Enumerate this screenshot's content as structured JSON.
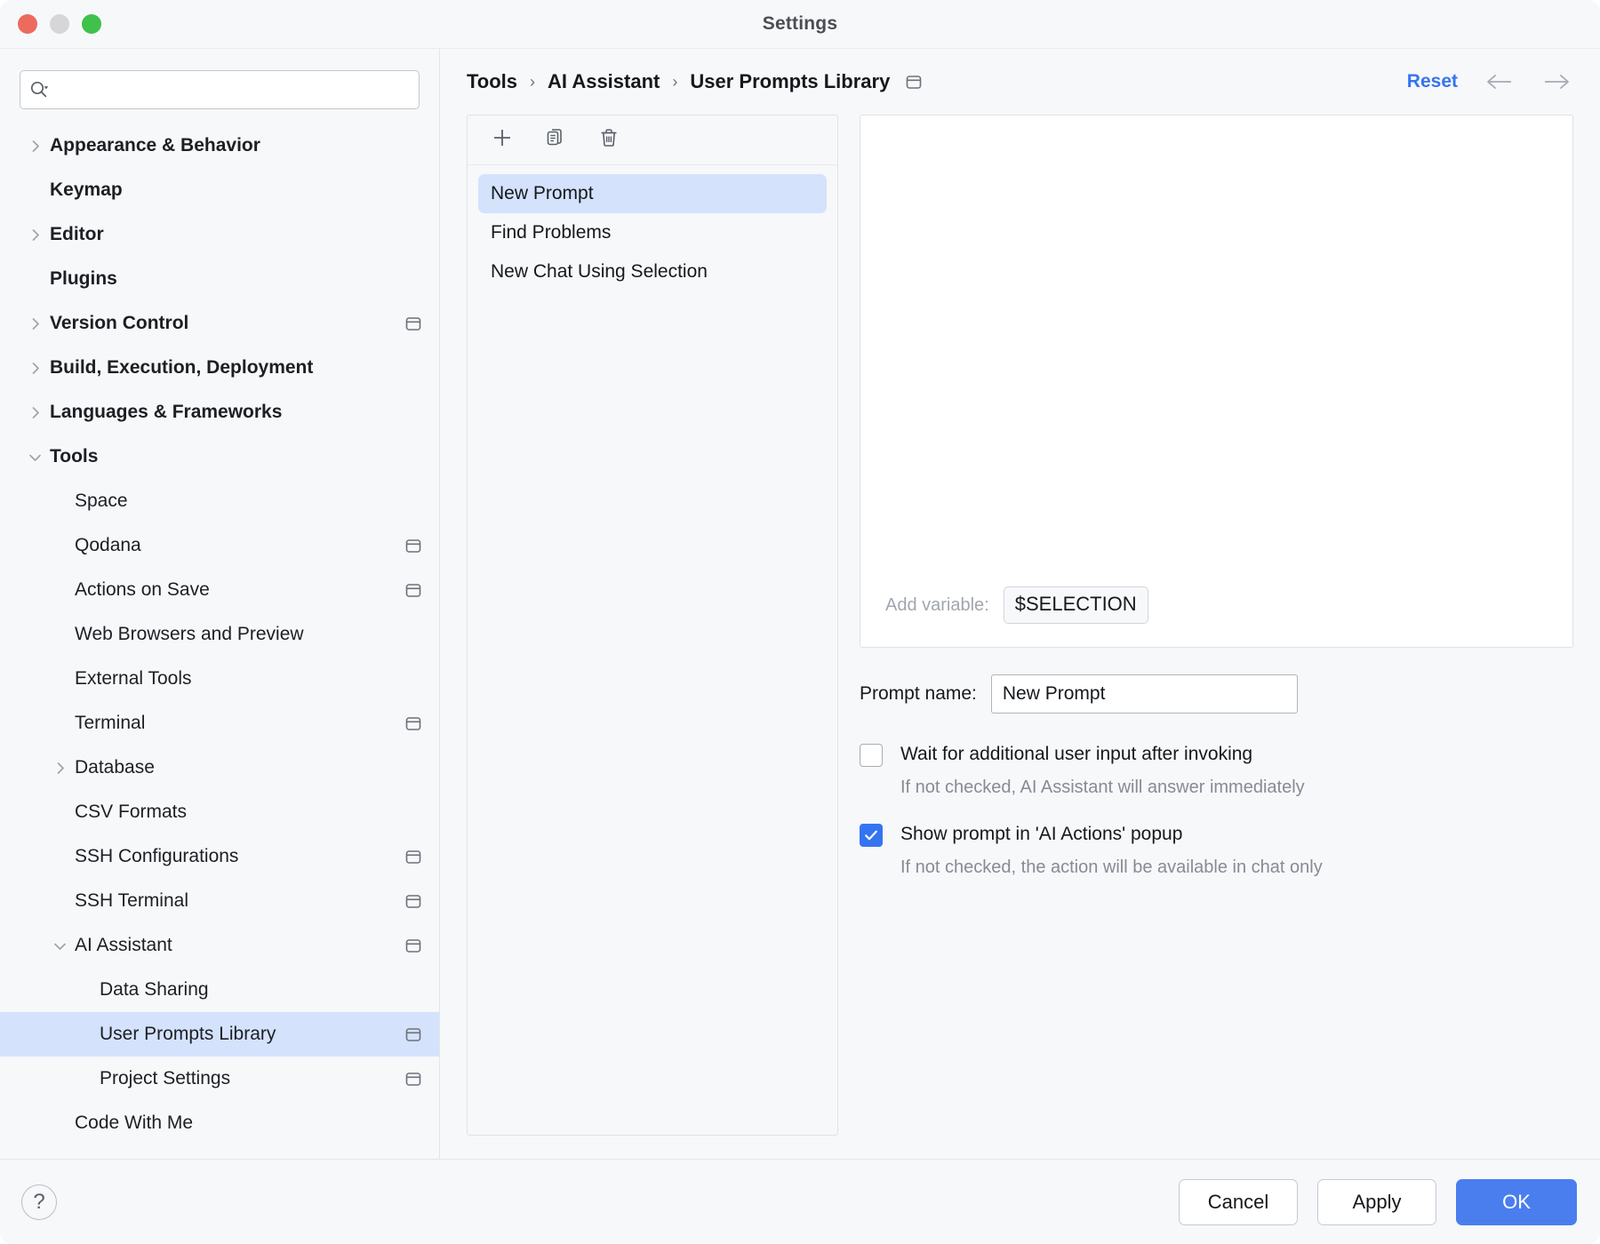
{
  "window": {
    "title": "Settings",
    "traffic_lights": [
      "close",
      "minimize",
      "zoom"
    ]
  },
  "search": {
    "value": "",
    "placeholder": ""
  },
  "sidebar": {
    "items": [
      {
        "label": "Appearance & Behavior",
        "level": 0,
        "twisty": "collapsed",
        "badge": false,
        "selected": false
      },
      {
        "label": "Keymap",
        "level": 0,
        "twisty": "none",
        "badge": false,
        "selected": false
      },
      {
        "label": "Editor",
        "level": 0,
        "twisty": "collapsed",
        "badge": false,
        "selected": false
      },
      {
        "label": "Plugins",
        "level": 0,
        "twisty": "none",
        "badge": false,
        "selected": false
      },
      {
        "label": "Version Control",
        "level": 0,
        "twisty": "collapsed",
        "badge": true,
        "selected": false
      },
      {
        "label": "Build, Execution, Deployment",
        "level": 0,
        "twisty": "collapsed",
        "badge": false,
        "selected": false
      },
      {
        "label": "Languages & Frameworks",
        "level": 0,
        "twisty": "collapsed",
        "badge": false,
        "selected": false
      },
      {
        "label": "Tools",
        "level": 0,
        "twisty": "expanded",
        "badge": false,
        "selected": false
      },
      {
        "label": "Space",
        "level": 1,
        "twisty": "none",
        "badge": false,
        "selected": false
      },
      {
        "label": "Qodana",
        "level": 1,
        "twisty": "none",
        "badge": true,
        "selected": false
      },
      {
        "label": "Actions on Save",
        "level": 1,
        "twisty": "none",
        "badge": true,
        "selected": false
      },
      {
        "label": "Web Browsers and Preview",
        "level": 1,
        "twisty": "none",
        "badge": false,
        "selected": false
      },
      {
        "label": "External Tools",
        "level": 1,
        "twisty": "none",
        "badge": false,
        "selected": false
      },
      {
        "label": "Terminal",
        "level": 1,
        "twisty": "none",
        "badge": true,
        "selected": false
      },
      {
        "label": "Database",
        "level": 1,
        "twisty": "collapsed",
        "badge": false,
        "selected": false
      },
      {
        "label": "CSV Formats",
        "level": 1,
        "twisty": "none",
        "badge": false,
        "selected": false
      },
      {
        "label": "SSH Configurations",
        "level": 1,
        "twisty": "none",
        "badge": true,
        "selected": false
      },
      {
        "label": "SSH Terminal",
        "level": 1,
        "twisty": "none",
        "badge": true,
        "selected": false
      },
      {
        "label": "AI Assistant",
        "level": 1,
        "twisty": "expanded",
        "badge": true,
        "selected": false
      },
      {
        "label": "Data Sharing",
        "level": 2,
        "twisty": "none",
        "badge": false,
        "selected": false
      },
      {
        "label": "User Prompts Library",
        "level": 2,
        "twisty": "none",
        "badge": true,
        "selected": true
      },
      {
        "label": "Project Settings",
        "level": 2,
        "twisty": "none",
        "badge": true,
        "selected": false
      },
      {
        "label": "Code With Me",
        "level": 1,
        "twisty": "none",
        "badge": false,
        "selected": false
      }
    ]
  },
  "header": {
    "breadcrumb": [
      "Tools",
      "AI Assistant",
      "User Prompts Library"
    ],
    "separator": "›",
    "badge": true,
    "reset_label": "Reset",
    "back_arrow": "←",
    "forward_arrow": "→",
    "reset_color": "#3574F0"
  },
  "prompt_list": {
    "toolbar": [
      {
        "name": "add-prompt",
        "icon": "plus-icon"
      },
      {
        "name": "duplicate-prompt",
        "icon": "copy-icon"
      },
      {
        "name": "delete-prompt",
        "icon": "trash-icon"
      }
    ],
    "items": [
      {
        "label": "New Prompt",
        "selected": true
      },
      {
        "label": "Find Problems",
        "selected": false
      },
      {
        "label": "New Chat Using Selection",
        "selected": false
      }
    ]
  },
  "editor": {
    "text": "",
    "add_variable_label": "Add variable:",
    "variable_chip": "$SELECTION"
  },
  "form": {
    "prompt_name_label": "Prompt name:",
    "prompt_name_value": "New Prompt",
    "checkboxes": [
      {
        "label": "Wait for additional user input after invoking",
        "hint": "If not checked, AI Assistant will answer immediately",
        "checked": false
      },
      {
        "label": "Show prompt in 'AI Actions' popup",
        "hint": "If not checked, the action will be available in chat only",
        "checked": true
      }
    ]
  },
  "footer": {
    "help_glyph": "?",
    "cancel_label": "Cancel",
    "apply_label": "Apply",
    "ok_label": "OK",
    "ok_color": "#4A7EEF"
  }
}
